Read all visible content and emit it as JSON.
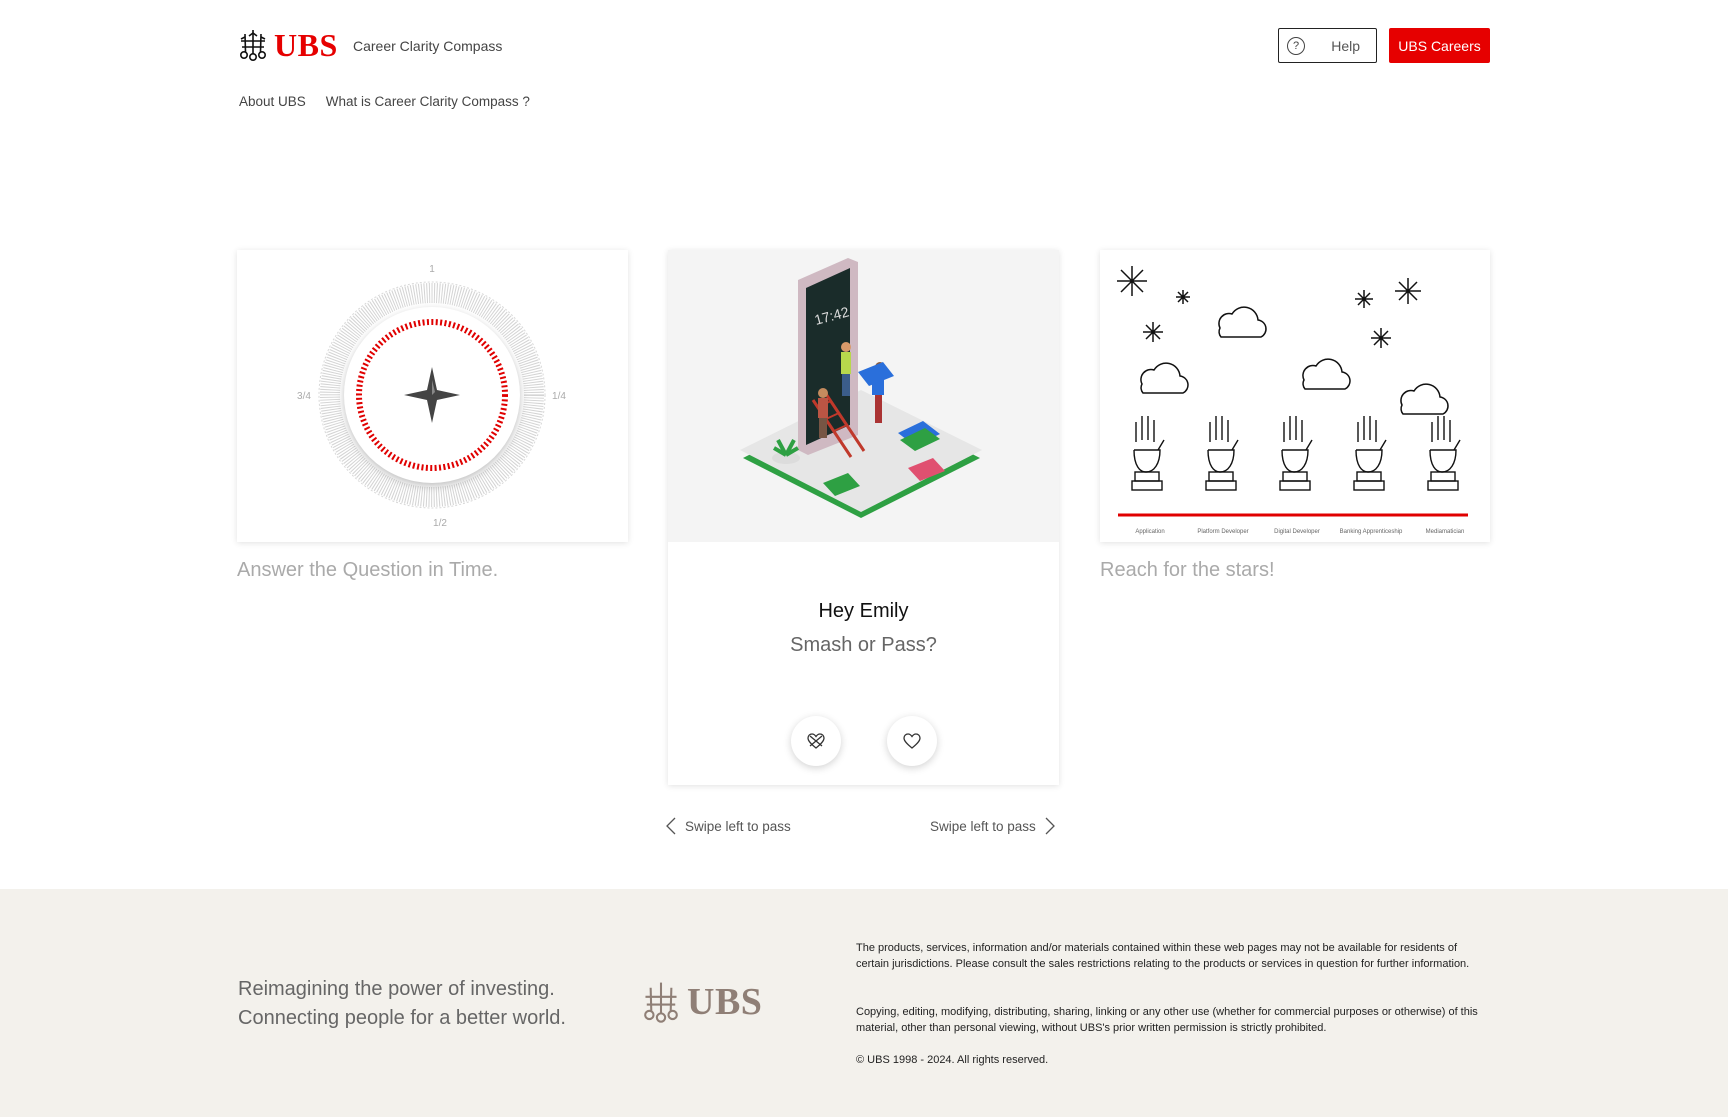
{
  "header": {
    "brand": "UBS",
    "app_name": "Career Clarity Compass",
    "help_label": "Help",
    "careers_label": "UBS Careers"
  },
  "nav": {
    "items": [
      "About UBS",
      "What is Career Clarity Compass ?"
    ]
  },
  "cards": {
    "left": {
      "caption": "Answer the Question in Time.",
      "dial_labels": [
        "1",
        "1/4",
        "1/2",
        "3/4"
      ]
    },
    "middle": {
      "phone_time": "17:42",
      "greeting": "Hey Emily",
      "prompt": "Smash or Pass?",
      "pass_icon": "broken-heart-icon",
      "like_icon": "heart-icon"
    },
    "right": {
      "caption": "Reach for the stars!",
      "roles": [
        "Application",
        "Platform Developer",
        "Digital Developer",
        "Banking Apprenticeship",
        "Mediamatician"
      ]
    }
  },
  "swipe": {
    "left_label": "Swipe left to pass",
    "right_label": "Swipe left to pass"
  },
  "footer": {
    "tagline_1": "Reimagining the power of investing.",
    "tagline_2": "Connecting people for a better world.",
    "brand": "UBS",
    "legal_1": "The products, services, information and/or materials contained within these web pages may not be available for residents of certain jurisdictions. Please consult the sales restrictions relating to the products or services in question for further information.",
    "legal_2": "Copying, editing, modifying, distributing, sharing, linking or any other use (whether for commercial purposes or otherwise) of this material, other than personal viewing, without UBS's prior written permission is strictly prohibited.",
    "copyright": "© UBS 1998 - 2024. All rights reserved."
  },
  "colors": {
    "brand_red": "#e60000",
    "footer_bg": "#f3f1ec",
    "footer_logo": "#8f7f76"
  }
}
